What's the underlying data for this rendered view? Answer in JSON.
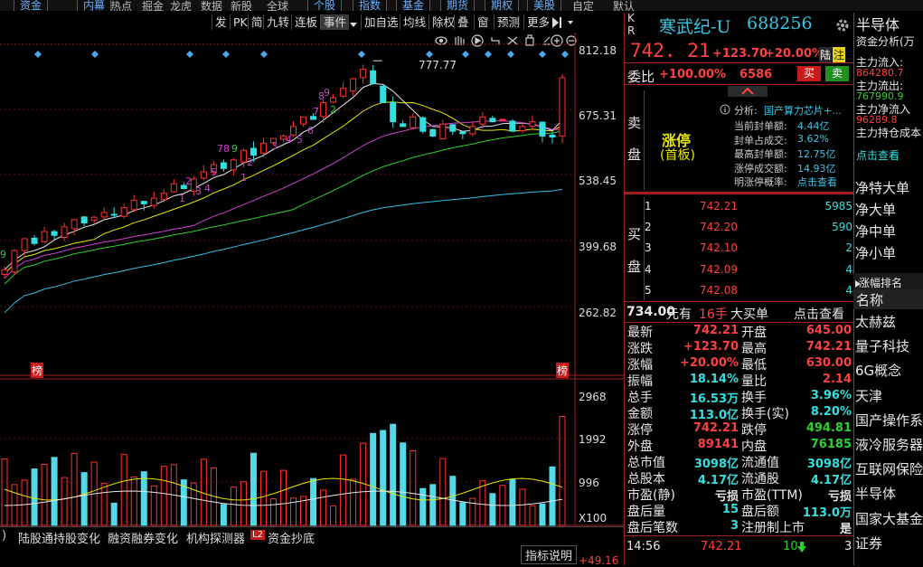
{
  "top_nav": {
    "items": [
      "资金",
      "内幕",
      "热点",
      "掘金",
      "龙虎",
      "数据",
      "新股",
      "全球",
      "个股",
      "指数",
      "基金",
      "期货",
      "期权",
      "美股",
      "自定",
      "默认"
    ]
  },
  "toolbar": {
    "items": [
      "发",
      "PK",
      "简",
      "九转",
      "连板",
      "事件",
      "加自选",
      "均线",
      "除权",
      "叠",
      "窗",
      "预测",
      "更多"
    ]
  },
  "chart": {
    "y_ticks": [
      "812.18",
      "675.31",
      "538.45",
      "399.68",
      "262.82"
    ],
    "high_label": "777.77",
    "bang_left": "榜",
    "bang_right": "榜",
    "volume_ticks": [
      "2968",
      "1992",
      "996"
    ],
    "volume_unit": "X100",
    "ma_numbers": [
      "9",
      "1",
      "2",
      "3",
      "4",
      "5",
      "7",
      "8",
      "9",
      "1",
      "2",
      "3",
      "4",
      "5",
      "6",
      "7",
      "8",
      "9",
      "2",
      "3",
      "4",
      "5",
      "6",
      "7",
      "8",
      "9"
    ]
  },
  "chart_data": {
    "type": "candlestick",
    "title": "",
    "ylim": [
      262.82,
      812.18
    ],
    "y_ticks": [
      812.18,
      675.31,
      538.45,
      399.68,
      262.82
    ],
    "high_annotation": 777.77,
    "last_close": 742.21,
    "volume_ticks": [
      2968,
      1992,
      996
    ],
    "volume_unit": "X100",
    "close_series": [
      340,
      380,
      405,
      395,
      420,
      412,
      430,
      445,
      438,
      450,
      460,
      455,
      470,
      485,
      478,
      490,
      500,
      520,
      510,
      530,
      545,
      560,
      552,
      570,
      590,
      580,
      605,
      615,
      620,
      640,
      660,
      655,
      690,
      700,
      720,
      740,
      760,
      730,
      690,
      650,
      640,
      660,
      630,
      620,
      645,
      630,
      625,
      640,
      660,
      650,
      655,
      630,
      640,
      650,
      620,
      618,
      742.21
    ]
  },
  "bottom_tabs": [
    "陆股通持股变化",
    "融资融券变化",
    "机构探测器",
    "资金抄底"
  ],
  "bottom_tab_l2": "L2",
  "indicator_button": "指标说明",
  "bottom_left_value": "+49.16",
  "stock": {
    "kr_top": "K",
    "kr_bottom": "R",
    "name": "寒武纪-U",
    "code": "688256",
    "price": "742. 21",
    "change": "+123.70",
    "change_pct": "+20.00%",
    "tag_lu": "陆",
    "tag_zhu": "注",
    "weibi_label": "委比",
    "weibi_value": "+100.00%",
    "weicha_value": "6586",
    "buy_btn": "买",
    "sell_btn": "卖"
  },
  "limit_info": {
    "sell_label": [
      "卖",
      "盘"
    ],
    "status": "涨停",
    "status_sub": "(首板)",
    "analysis_label": "分析:",
    "analysis_value": "国产算力芯片+...",
    "rows": [
      {
        "label": "当前封单额:",
        "value": "4.44亿"
      },
      {
        "label": "封单占成交:",
        "value": "3.62%"
      },
      {
        "label": "最高封单额:",
        "value": "12.75亿"
      },
      {
        "label": "涨停成交额:",
        "value": "14.93亿"
      }
    ],
    "prob_label": "明涨停概率:",
    "prob_value": "点击查看"
  },
  "order_book": {
    "buy_label": [
      "买",
      "盘"
    ],
    "bids": [
      {
        "level": "1",
        "price": "742.21",
        "volume": "5985"
      },
      {
        "level": "2",
        "price": "742.20",
        "volume": "590"
      },
      {
        "level": "3",
        "price": "742.10",
        "volume": "2"
      },
      {
        "level": "4",
        "price": "742.09",
        "volume": "4"
      },
      {
        "level": "5",
        "price": "742.08",
        "volume": "4"
      }
    ]
  },
  "big_order_bar": {
    "price": "734.00",
    "you": "元有",
    "count": "16手",
    "label": "大买单",
    "link": "点击查看"
  },
  "quote": {
    "rows": [
      {
        "l1": "最新",
        "v1": "742.21",
        "c1": "red",
        "l2": "开盘",
        "v2": "645.00",
        "c2": "red"
      },
      {
        "l1": "涨跌",
        "v1": "+123.70",
        "c1": "red",
        "l2": "最高",
        "v2": "742.21",
        "c2": "red"
      },
      {
        "l1": "涨幅",
        "v1": "+20.00%",
        "c1": "red",
        "l2": "最低",
        "v2": "630.00",
        "c2": "red"
      },
      {
        "l1": "振幅",
        "v1": "18.14%",
        "c1": "cyan",
        "l2": "量比",
        "v2": "2.14",
        "c2": "red"
      },
      {
        "l1": "总手",
        "v1": "16.53万",
        "c1": "cyan",
        "l2": "换手",
        "v2": "3.96%",
        "c2": "cyan"
      },
      {
        "l1": "金额",
        "v1": "113.0亿",
        "c1": "cyan",
        "l2": "换手(实)",
        "v2": "8.20%",
        "c2": "cyan"
      },
      {
        "l1": "涨停",
        "v1": "742.21",
        "c1": "red",
        "l2": "跌停",
        "v2": "494.81",
        "c2": "green"
      },
      {
        "l1": "外盘",
        "v1": "89141",
        "c1": "red",
        "l2": "内盘",
        "v2": "76185",
        "c2": "green"
      },
      {
        "l1": "总市值",
        "v1": "3098亿",
        "c1": "cyan",
        "l2": "流通值",
        "v2": "3098亿",
        "c2": "cyan"
      },
      {
        "l1": "总股本",
        "v1": "4.17亿",
        "c1": "cyan",
        "l2": "流通股",
        "v2": "4.17亿",
        "c2": "cyan"
      },
      {
        "l1": "市盈(静)",
        "v1": "亏损",
        "c1": "white",
        "l2": "市盈(TTM)",
        "v2": "亏损",
        "c2": "white"
      },
      {
        "l1": "盘后量",
        "v1": "15",
        "c1": "cyan",
        "l2": "盘后额",
        "v2": "113.0万",
        "c2": "cyan"
      },
      {
        "l1": "盘后笔数",
        "v1": "3",
        "c1": "cyan",
        "l2": "注册制上市",
        "v2": "是",
        "c2": "white"
      }
    ]
  },
  "tick": {
    "time": "14:56",
    "price": "742.21",
    "vol": "10",
    "extra": "3"
  },
  "sector_panel": {
    "title": "半导体",
    "fund_title": "资金分析(万",
    "rows": [
      {
        "label": "主力流入:",
        "value": "864280.7",
        "color": "red"
      },
      {
        "label": "主力流出:",
        "value": "767990.9",
        "color": "green"
      },
      {
        "label": "主力净流入",
        "value": "96289.8",
        "color": "red"
      },
      {
        "label": "主力持仓成本",
        "value": "",
        "color": "white"
      }
    ],
    "link": "点击查看",
    "flows": [
      "净特大单",
      "净大单",
      "净中单",
      "净小单"
    ],
    "rank_title": "涨幅排名",
    "name_header": "名称",
    "concepts": [
      "太赫兹",
      "量子科技",
      "6G概念",
      "天津",
      "国产操作系",
      "液冷服务器",
      "互联网保险",
      "半导体",
      "国家大基金",
      "证券"
    ]
  }
}
